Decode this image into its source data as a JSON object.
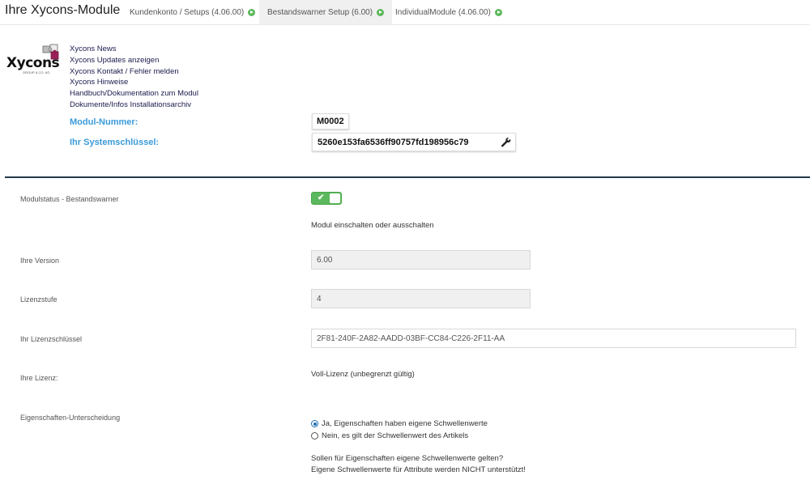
{
  "app_title": "Ihre Xycons-Module",
  "tabs": [
    {
      "label": "Kundenkonto / Setups (4.06.00)"
    },
    {
      "label": "Bestandswarner Setup (6.00)"
    },
    {
      "label": "IndividualModule (4.06.00)"
    }
  ],
  "logo": {
    "text": "Xycons",
    "sub": "GROUP & CO. KG"
  },
  "links": [
    "Xycons News",
    "Xycons Updates anzeigen",
    "Xycons Kontakt / Fehler melden",
    "Xycons Hinweise",
    "Handbuch/Dokumentation zum Modul",
    "Dokumente/Infos Installationsarchiv"
  ],
  "module": {
    "number_label": "Modul-Nummer:",
    "number_value": "M0002",
    "key_label": "Ihr Systemschlüssel:",
    "key_value": "5260e153fa6536ff90757fd198956c79"
  },
  "form": {
    "status_label": "Modulstatus - Bestandswarner",
    "status_on": true,
    "status_hint": "Modul einschalten oder ausschalten",
    "version_label": "Ihre Version",
    "version_value": "6.00",
    "level_label": "Lizenzstufe",
    "level_value": "4",
    "license_key_label": "Ihr Lizenzschlüssel",
    "license_key_value": "2F81-240F-2A82-AADD-03BF-CC84-C226-2F11-AA",
    "license_label": "Ihre Lizenz:",
    "license_value": "Voll-Lizenz (unbegrenzt gültig)",
    "props_label": "Eigenschaften-Unterscheidung",
    "props_options": [
      "Ja, Eigenschaften haben eigene Schwellenwerte",
      "Nein, es gilt der Schwellenwert des Artikels"
    ],
    "props_selected": 0,
    "props_hint_1": "Sollen für Eigenschaften eigene Schwellenwerte gelten?",
    "props_hint_2": "Eigene Schwellenwerte für Attribute werden NICHT unterstützt!"
  },
  "colors": {
    "accent": "#3a9ad9",
    "toggle_on": "#5cb85c",
    "divider": "#243a4a"
  }
}
